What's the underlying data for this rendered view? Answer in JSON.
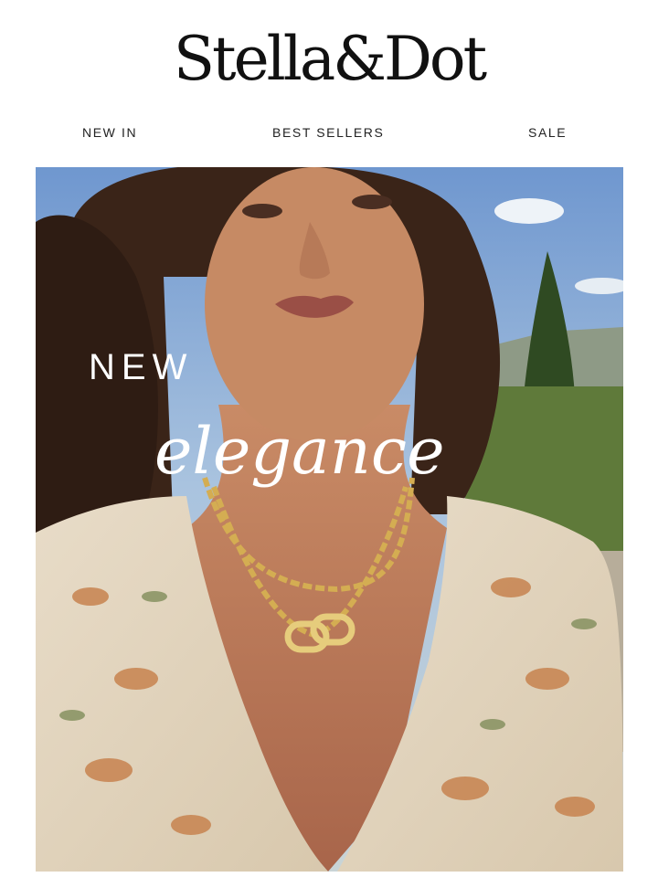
{
  "brand": {
    "logo_text": "Stella&Dot"
  },
  "nav": {
    "items": [
      {
        "label": "NEW IN"
      },
      {
        "label": "BEST SELLERS"
      },
      {
        "label": "SALE"
      }
    ]
  },
  "hero": {
    "line1": "NEW",
    "line2": "elegance",
    "text_color": "#ffffff"
  }
}
